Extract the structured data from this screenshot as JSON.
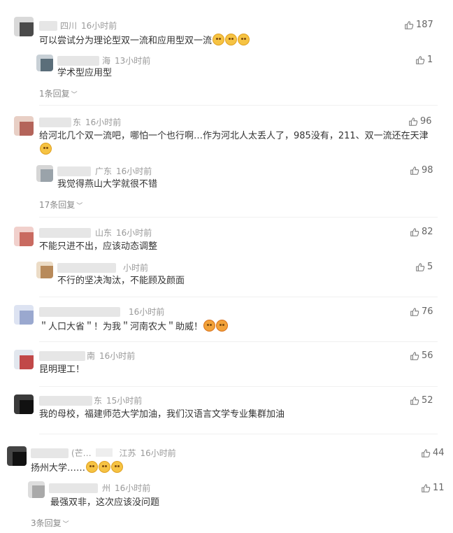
{
  "comments": [
    {
      "location": "四川",
      "time": "16小时前",
      "text": "可以尝试分为理论型双一流和应用型双一流",
      "emoji_count": 3,
      "likes": "187",
      "reply": {
        "location": "海",
        "time": "13小时前",
        "text": "学术型应用型",
        "likes": "1"
      },
      "more": "1条回复"
    },
    {
      "location": "东",
      "time": "16小时前",
      "text": "给河北几个双一流吧，哪怕一个也行啊…作为河北人太丢人了，985没有，211、双一流还在天津",
      "likes": "96",
      "reply": {
        "location": "广东",
        "time": "16小时前",
        "text": "我觉得燕山大学就很不错",
        "likes": "98"
      },
      "more": "17条回复"
    },
    {
      "location": "山东",
      "time": "16小时前",
      "text": "不能只进不出，应该动态调整",
      "likes": "82",
      "reply": {
        "location": "",
        "time": "小时前",
        "text": "不行的坚决淘汰，不能顾及颜面",
        "likes": "5"
      }
    },
    {
      "location": "",
      "time": "16小时前",
      "text": "＂人口大省＂！为我＂河南农大＂助威！",
      "likes": "76"
    },
    {
      "location": "南",
      "time": "16小时前",
      "text": "昆明理工！",
      "likes": "56"
    },
    {
      "location": "东",
      "time": "15小时前",
      "text": "我的母校，福建师范大学加油，我们汉语言文学专业集群加油",
      "likes": "52"
    },
    {
      "name_suffix": "(芒…",
      "location": "江苏",
      "time": "16小时前",
      "text": "扬州大学……",
      "likes": "44",
      "reply": {
        "location": "州",
        "time": "16小时前",
        "text": "最强双非，这次应该没问题",
        "likes": "11"
      },
      "more": "3条回复"
    }
  ],
  "colors": {
    "text": "#333333",
    "meta": "#999999",
    "like": "#666666"
  }
}
